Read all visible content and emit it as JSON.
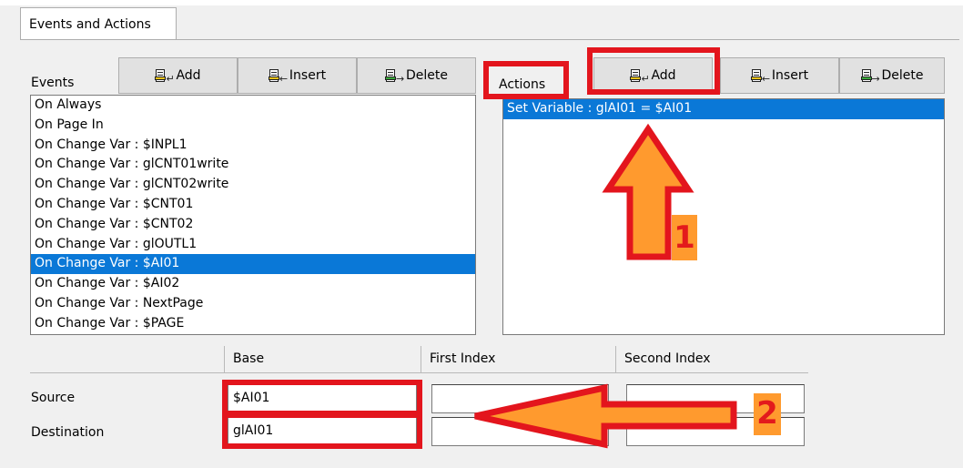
{
  "tab": {
    "label": "Events and Actions"
  },
  "events": {
    "label": "Events",
    "buttons": {
      "add": "Add",
      "insert": "Insert",
      "delete": "Delete"
    },
    "items": [
      "On Always",
      "On Page In",
      "On Change Var : $INPL1",
      "On Change Var : glCNT01write",
      "On Change Var : glCNT02write",
      "On Change Var : $CNT01",
      "On Change Var : $CNT02",
      "On Change Var : glOUTL1",
      "On Change Var : $AI01",
      "On Change Var : $AI02",
      "On Change Var : NextPage",
      "On Change Var : $PAGE"
    ],
    "selected_index": 8
  },
  "actions": {
    "label": "Actions",
    "buttons": {
      "add": "Add",
      "insert": "Insert",
      "delete": "Delete"
    },
    "items": [
      "Set Variable : glAI01 = $AI01"
    ],
    "selected_index": 0
  },
  "params": {
    "columns": {
      "base": "Base",
      "first_index": "First Index",
      "second_index": "Second Index"
    },
    "rows": {
      "source": {
        "label": "Source",
        "base": "$AI01",
        "first_index": "",
        "second_index": ""
      },
      "destination": {
        "label": "Destination",
        "base": "glAI01",
        "first_index": "",
        "second_index": ""
      }
    }
  },
  "annotations": {
    "step1": "1",
    "step2": "2",
    "highlight_color": "#e3151d",
    "arrow_fill": "#ff9a2e"
  },
  "icons": {
    "add": "add-row-icon",
    "insert": "insert-row-icon",
    "delete": "delete-row-icon"
  }
}
